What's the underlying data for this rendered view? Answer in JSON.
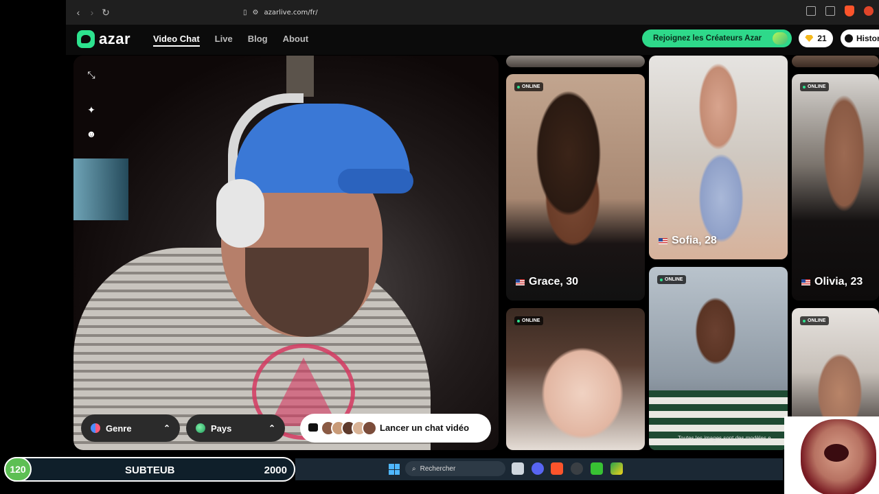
{
  "browser": {
    "url": "azarlive.com/fr/"
  },
  "header": {
    "logo_text": "azar",
    "nav": [
      {
        "label": "Video Chat",
        "active": true
      },
      {
        "label": "Live",
        "active": false
      },
      {
        "label": "Blog",
        "active": false
      },
      {
        "label": "About",
        "active": false
      }
    ],
    "creators_button": "Rejoignez les Créateurs Azar",
    "gems_count": "21",
    "history_label": "Histor"
  },
  "video": {
    "filter_gender": "Genre",
    "filter_country": "Pays",
    "launch_button": "Lancer un chat vidéo"
  },
  "gallery": {
    "online_label": "ONLINE",
    "cards": [
      {
        "name": "Grace, 30"
      },
      {
        "name": "Sofia, 28"
      },
      {
        "name": "Olivia, 23"
      }
    ],
    "disclaimer": "Toutes les images sont des modèles e"
  },
  "overlay": {
    "score_value": "120",
    "score_name": "SUBTEUB",
    "score_target": "2000"
  },
  "taskbar": {
    "search_placeholder": "Rechercher"
  },
  "colors": {
    "brand_green": "#2de28e",
    "online_dot": "#2de28e",
    "score_green": "#5dbf54"
  }
}
